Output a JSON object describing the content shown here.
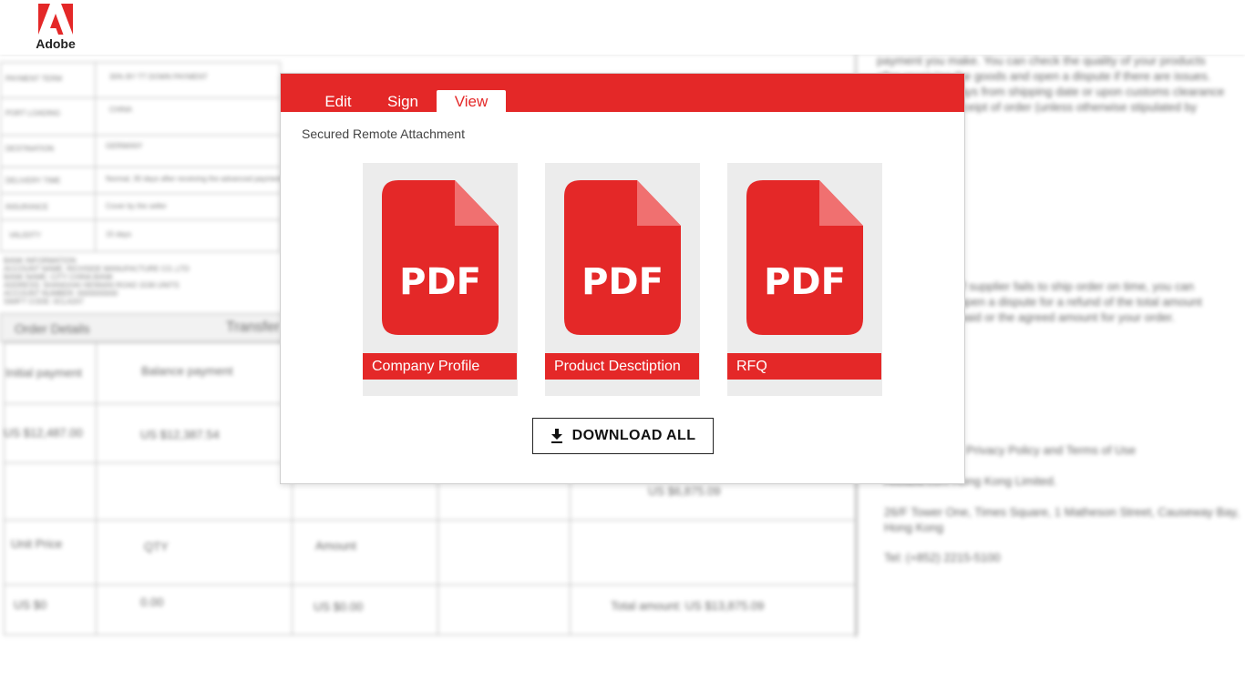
{
  "brand": {
    "logo_text": "Adobe",
    "accent": "#e42828"
  },
  "tabs": [
    {
      "label": "Edit",
      "active": false
    },
    {
      "label": "Sign",
      "active": false
    },
    {
      "label": "View",
      "active": true
    }
  ],
  "attachment": {
    "title": "Secured Remote Attachment",
    "files": [
      {
        "icon": "pdf-file-icon",
        "icon_text": "PDF",
        "name": "Company Profile"
      },
      {
        "icon": "pdf-file-icon",
        "icon_text": "PDF",
        "name": "Product Desctiption"
      },
      {
        "icon": "pdf-file-icon",
        "icon_text": "PDF",
        "name": "RFQ"
      }
    ],
    "download_label": "DOWNLOAD ALL",
    "download_icon": "download-icon"
  },
  "background_document": {
    "left_rows": [
      "PAYMENT TERM",
      "PORT LOADING",
      "DESTINATION",
      "DELIVERY TIME",
      "INSURANCE",
      "VALIDITY"
    ],
    "left_values": [
      "30% BY TT DOWN PAYMENT",
      "CHINA",
      "GERMANY",
      "Normal, 30 days after receiving the advanced payment",
      "Cover by the seller",
      "15 days"
    ],
    "bank_lines": [
      "BANK INFORMATION",
      "ACCOUNT NAME: RICHSIDE MANUFACTURE CO.,LTD",
      "BANK NAME: CITY CHINA BANK",
      "ADDRESS: SHANGHAI HENNAN ROAD 1536 UNITS",
      "ACCOUNT NUMBER: 0000000000",
      "SWIFT CODE: 0CLA207"
    ],
    "order_details": "Order Details",
    "transfer": "Transfer",
    "table": {
      "initial_payment": "Initial payment",
      "balance_payment": "Balance payment",
      "initial_value": "US $12,487.00",
      "balance_value": "US $12,387.54",
      "mid_value": "US $6,875.09",
      "unit_price": "Unit Price",
      "qty": "QTY",
      "amount": "Amount",
      "unit_value": "US $0",
      "qty_value": "0.00",
      "amount_value": "US $0.00",
      "total": "Total amount: US $13,875.09"
    },
    "right_para_1": "payment you make. You can check the quality of your products after receiving the goods and open a dispute if there are issues. You'll have 60 days from shipping date or upon customs clearance to confirm the receipt of order (unless otherwise stipulated by contract).",
    "right_para_2": "If supplier fails to ship order on time, you can open a dispute for a refund of the total amount paid or the agreed amount for your order.",
    "right_policy": "Privacy Policy and Terms of Use",
    "right_company": "Alibaba.com Hong Kong Limited.",
    "right_address": "26/F Tower One, Times Square, 1 Matheson Street, Causeway Bay, Hong Kong",
    "right_tel": "Tel: (+852) 2215-5100"
  }
}
